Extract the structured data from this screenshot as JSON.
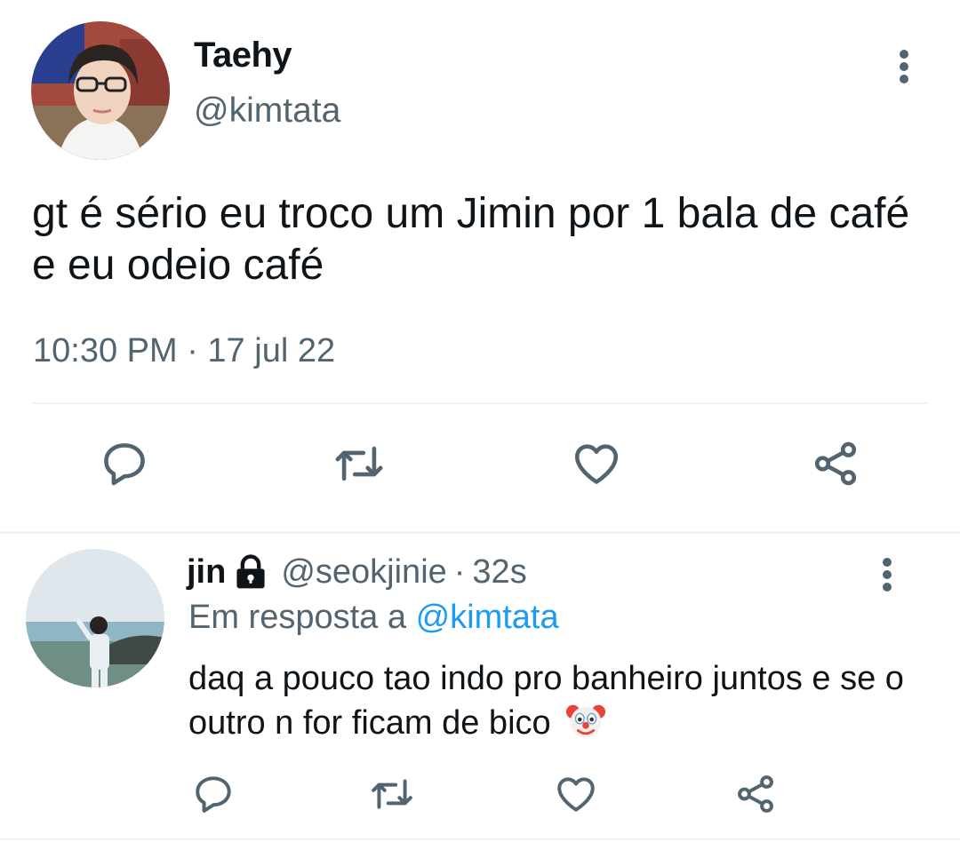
{
  "main_tweet": {
    "display_name": "Taehy",
    "handle": "@kimtata",
    "text": "gt é sério eu troco um Jimin por 1 bala de café e eu odeio café",
    "timestamp": "10:30 PM · 17 jul 22",
    "actions": [
      "reply-icon",
      "retweet-icon",
      "like-icon",
      "share-icon"
    ]
  },
  "reply": {
    "display_name": "jin",
    "handle": "@seokjinie",
    "separator": "·",
    "time": "32s",
    "in_reply_prefix": "Em resposta a ",
    "in_reply_mention": "@kimtata",
    "text": "daq a pouco tao indo pro banheiro juntos e se o outro n for ficam de bico",
    "emoji": "clown-face",
    "actions": [
      "reply-icon",
      "retweet-icon",
      "like-icon",
      "share-icon"
    ]
  },
  "colors": {
    "text_primary": "#0f1419",
    "text_secondary": "#536471",
    "link": "#1d9bf0",
    "divider": "#eff3f4"
  }
}
